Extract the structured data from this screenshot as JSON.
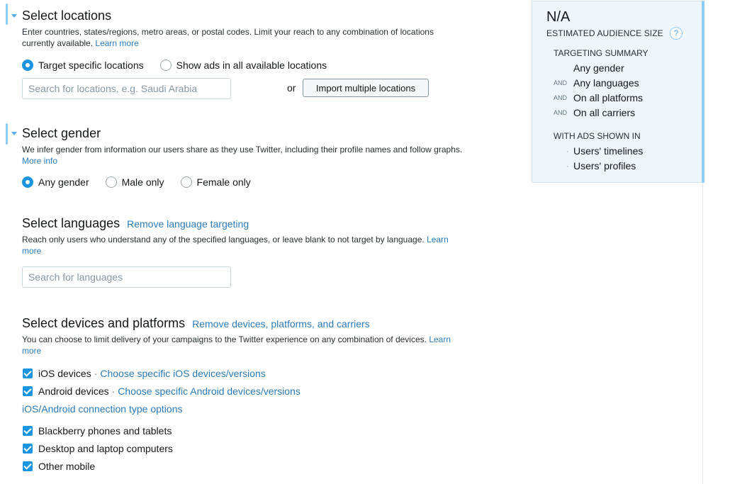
{
  "locations": {
    "title": "Select locations",
    "desc": "Enter countries, states/regions, metro areas, or postal codes. Limit your reach to any combination of locations currently available.",
    "learn_more": "Learn more",
    "option_specific": "Target specific locations",
    "option_all": "Show ads in all available locations",
    "search_placeholder": "Search for locations, e.g. Saudi Arabia",
    "or": "or",
    "import_button": "Import multiple locations"
  },
  "gender": {
    "title": "Select gender",
    "desc": "We infer gender from information our users share as they use Twitter, including their profile names and follow graphs.",
    "more_info": "More info",
    "option_any": "Any gender",
    "option_male": "Male only",
    "option_female": "Female only"
  },
  "languages": {
    "title": "Select languages",
    "remove_link": "Remove language targeting",
    "desc": "Reach only users who understand any of the specified languages, or leave blank to not target by language.",
    "learn_more": "Learn more",
    "search_placeholder": "Search for languages"
  },
  "devices": {
    "title": "Select devices and platforms",
    "remove_link": "Remove devices, platforms, and carriers",
    "desc": "You can choose to limit delivery of your campaigns to the Twitter experience on any combination of devices.",
    "learn_more": "Learn more",
    "separator": "·",
    "ios_label": "iOS devices",
    "ios_link": "Choose specific iOS devices/versions",
    "android_label": "Android devices",
    "android_link": "Choose specific Android devices/versions",
    "connection_link": "iOS/Android connection type options",
    "blackberry": "Blackberry phones and tablets",
    "desktop": "Desktop and laptop computers",
    "other_mobile": "Other mobile"
  },
  "summary": {
    "audience_size": "N/A",
    "estimated_label": "ESTIMATED AUDIENCE SIZE",
    "help": "?",
    "targeting_header": "TARGETING SUMMARY",
    "and": "AND",
    "items": [
      "Any gender",
      "Any languages",
      "On all platforms",
      "On all carriers"
    ],
    "ads_shown_header": "WITH ADS SHOWN IN",
    "bullet": "·",
    "placements": [
      "Users' timelines",
      "Users' profiles"
    ]
  },
  "colors": {
    "accent": "#1b95e0",
    "link": "#2b7bb9",
    "section_bar": "#8ecdf8",
    "summary_bg": "#eef6fc"
  }
}
